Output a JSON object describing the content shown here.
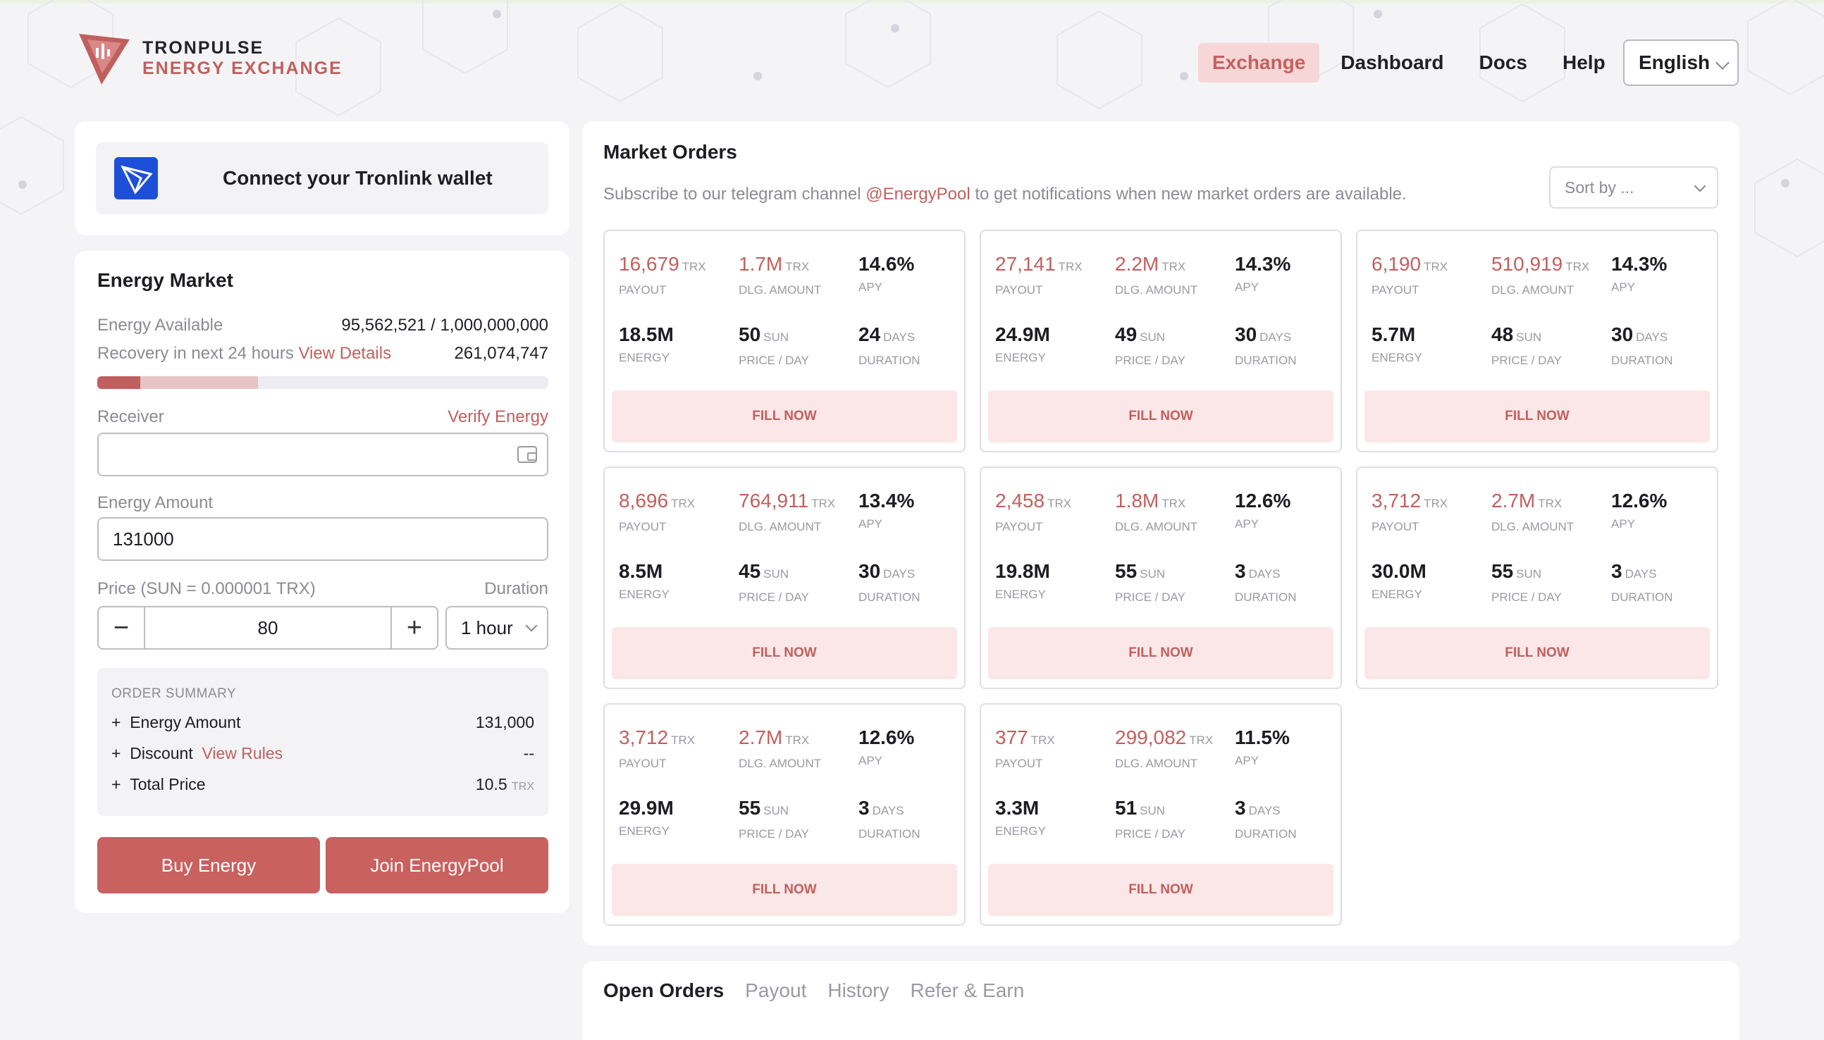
{
  "brand": {
    "line1": "TRONPULSE",
    "line2": "ENERGY EXCHANGE",
    "accent": "#c0605e"
  },
  "nav": {
    "items": [
      "Exchange",
      "Dashboard",
      "Docs",
      "Help"
    ],
    "active": "Exchange",
    "language": "English"
  },
  "wallet": {
    "connect_label": "Connect your Tronlink wallet",
    "icon": "tronlink-icon"
  },
  "market": {
    "title": "Energy Market",
    "available_label": "Energy Available",
    "available_value": "95,562,521 / 1,000,000,000",
    "available_fraction": 0.0956,
    "recovery_label": "Recovery in next 24 hours",
    "recovery_link": "View Details",
    "recovery_value": "261,074,747",
    "recovery_fraction": 0.261,
    "receiver_label": "Receiver",
    "verify_label": "Verify Energy",
    "receiver_value": "",
    "amount_label": "Energy Amount",
    "amount_value": "131000",
    "price_label": "Price (SUN = 0.000001 TRX)",
    "duration_label": "Duration",
    "price_value": "80",
    "duration_value": "1 hour",
    "summary": {
      "title": "ORDER SUMMARY",
      "rows": [
        {
          "prefix": "+",
          "label": "Energy Amount",
          "link": "",
          "value": "131,000",
          "unit": ""
        },
        {
          "prefix": "+",
          "label": "Discount",
          "link": "View Rules",
          "value": "--",
          "unit": ""
        },
        {
          "prefix": "+",
          "label": "Total Price",
          "link": "",
          "value": "10.5",
          "unit": "TRX"
        }
      ]
    },
    "buy_label": "Buy Energy",
    "join_label": "Join EnergyPool"
  },
  "orders": {
    "title": "Market Orders",
    "subtitle_pre": "Subscribe to our telegram channel",
    "subtitle_link": "@EnergyPool",
    "subtitle_post": "to get notifications when new market orders are available.",
    "sort_placeholder": "Sort by ...",
    "labels": {
      "payout": "PAYOUT",
      "dlg": "DLG. AMOUNT",
      "apy": "APY",
      "energy": "ENERGY",
      "price": "PRICE / DAY",
      "duration": "DURATION"
    },
    "units": {
      "trx": "TRX",
      "sun": "SUN",
      "days": "DAYS"
    },
    "fill_label": "FILL NOW",
    "items": [
      {
        "payout": "16,679",
        "dlg": "1.7M",
        "apy": "14.6%",
        "energy": "18.5M",
        "price": "50",
        "duration": "24"
      },
      {
        "payout": "27,141",
        "dlg": "2.2M",
        "apy": "14.3%",
        "energy": "24.9M",
        "price": "49",
        "duration": "30"
      },
      {
        "payout": "6,190",
        "dlg": "510,919",
        "apy": "14.3%",
        "energy": "5.7M",
        "price": "48",
        "duration": "30"
      },
      {
        "payout": "8,696",
        "dlg": "764,911",
        "apy": "13.4%",
        "energy": "8.5M",
        "price": "45",
        "duration": "30"
      },
      {
        "payout": "2,458",
        "dlg": "1.8M",
        "apy": "12.6%",
        "energy": "19.8M",
        "price": "55",
        "duration": "3"
      },
      {
        "payout": "3,712",
        "dlg": "2.7M",
        "apy": "12.6%",
        "energy": "30.0M",
        "price": "55",
        "duration": "3"
      },
      {
        "payout": "3,712",
        "dlg": "2.7M",
        "apy": "12.6%",
        "energy": "29.9M",
        "price": "55",
        "duration": "3"
      },
      {
        "payout": "377",
        "dlg": "299,082",
        "apy": "11.5%",
        "energy": "3.3M",
        "price": "51",
        "duration": "3"
      }
    ]
  },
  "open_orders": {
    "tabs": [
      "Open Orders",
      "Payout",
      "History",
      "Refer & Earn"
    ],
    "active": "Open Orders"
  }
}
